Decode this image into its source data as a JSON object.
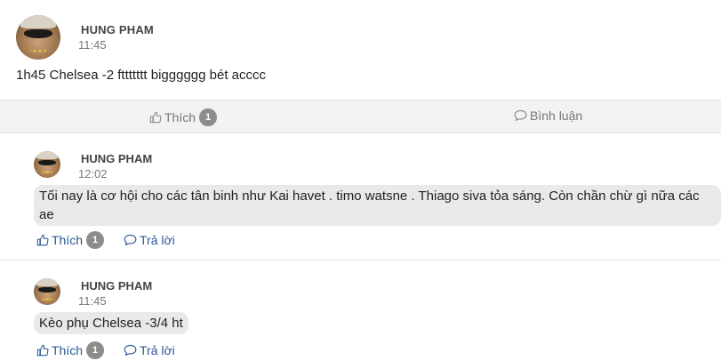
{
  "post": {
    "author": "HUNG PHAM",
    "time": "11:45",
    "text": "1h45 Chelsea -2 fttttttt bigggggg bét acccc",
    "avatar_icon": "avatar-icon"
  },
  "actionbar": {
    "like_label": "Thích",
    "like_count": "1",
    "comment_label": "Bình luận"
  },
  "comments": [
    {
      "author": "HUNG PHAM",
      "time": "12:02",
      "text": "Tối nay là cơ hội cho các tân binh như Kai havet . timo watsne . Thiago siva tỏa sáng. Còn chần chừ gì nữa các ae",
      "like_label": "Thích",
      "like_count": "1",
      "reply_label": "Trả lời"
    },
    {
      "author": "HUNG PHAM",
      "time": "11:45",
      "text": "Kèo phụ Chelsea -3/4 ht",
      "like_label": "Thích",
      "like_count": "1",
      "reply_label": "Trả lời"
    }
  ],
  "colors": {
    "link": "#2b5797",
    "badge": "#8c8c8c",
    "bubble": "#e9e9e9",
    "actionbar_bg": "#f2f2f2"
  }
}
